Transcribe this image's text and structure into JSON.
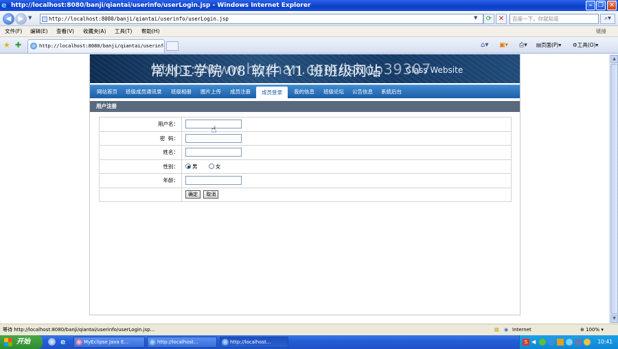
{
  "window": {
    "title": "http://localhost:8080/banji/qiantai/userinfo/userLogin.jsp - Windows Internet Explorer"
  },
  "address_bar": {
    "url": "http://localhost:8080/banji/qiantai/userinfo/userLogin.jsp",
    "search_placeholder": "百度一下，你就知道"
  },
  "menu": {
    "items": [
      "文件(F)",
      "编辑(E)",
      "查看(V)",
      "收藏夹(A)",
      "工具(T)",
      "帮助(H)"
    ],
    "links_label": "链接"
  },
  "tab": {
    "label": "http://localhost:8080/banji/qiantai/userinfo/userI..."
  },
  "toolbar": {
    "page_label": "页面(P)",
    "tools_label": "工具(O)"
  },
  "page": {
    "banner_title": "常州工学院 08 软件 Y1 班班级网站",
    "banner_subtitle": "Class Website",
    "watermark": "https://www.huzhan.com/ishop39307",
    "nav_items": [
      "网站首页",
      "班级成员通讯录",
      "班级相册",
      "图片上传",
      "成员注册",
      "成员登录",
      "我的信息",
      "班级论坛",
      "公告信息",
      "系统后台"
    ],
    "nav_active_index": 5,
    "section_title": "用户注册",
    "form": {
      "username_label": "用户名：",
      "password_label": "密  码：",
      "name_label": "姓名：",
      "gender_label": "性别：",
      "gender_options": [
        "男",
        "女"
      ],
      "gender_selected": "男",
      "age_label": "年龄：",
      "submit_label": "确定",
      "cancel_label": "取消"
    }
  },
  "statusbar": {
    "text": "等待 http://localhost:8080/banji/qiantai/userinfo/userLogin.jsp...",
    "zone": "Internet",
    "zoom": "100%"
  },
  "taskbar": {
    "start_label": "开始",
    "tasks": [
      "MyEclipse Java E...",
      "http://localhost...",
      "http://localhost..."
    ],
    "clock": "10:41"
  }
}
